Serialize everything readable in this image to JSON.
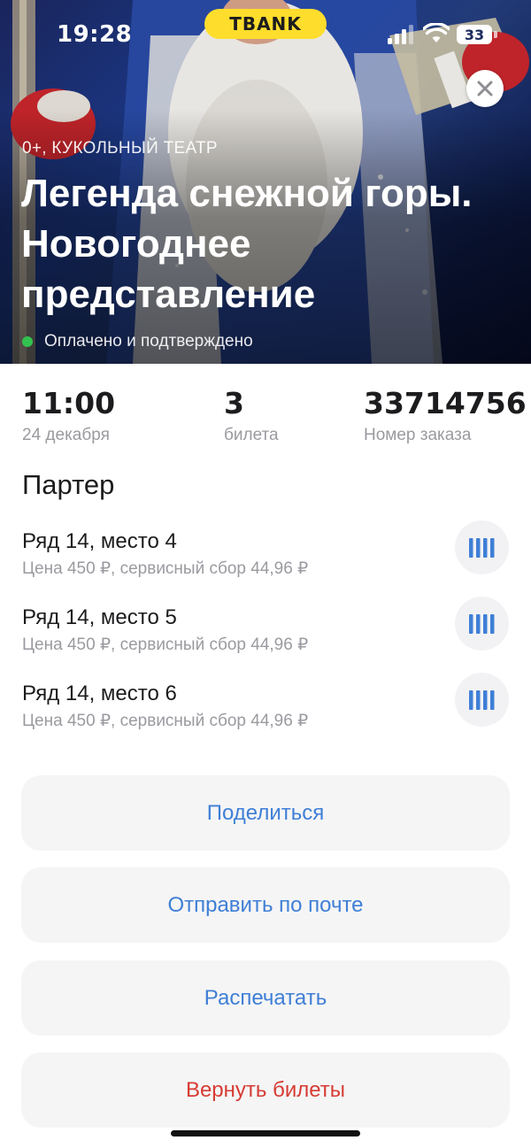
{
  "status_bar": {
    "time": "19:28",
    "brand": "TBANK",
    "battery": "33",
    "icons": [
      "signal-icon",
      "wifi-icon",
      "battery-icon"
    ]
  },
  "event": {
    "category": "0+, КУКОЛЬНЫЙ ТЕАТР",
    "title": "Легенда снежной горы. Новогоднее представление",
    "status": "Оплачено и подтверждено"
  },
  "info": {
    "time_value": "11:00",
    "time_label": "24 декабря",
    "count_value": "3",
    "count_label": "билета",
    "order_value": "33714756",
    "order_label": "Номер заказа"
  },
  "section": {
    "title": "Партер"
  },
  "tickets": [
    {
      "seat": "Ряд 14, место 4",
      "price": "Цена 450 ₽, сервисный сбор 44,96 ₽"
    },
    {
      "seat": "Ряд 14, место 5",
      "price": "Цена 450 ₽, сервисный сбор 44,96 ₽"
    },
    {
      "seat": "Ряд 14, место 6",
      "price": "Цена 450 ₽, сервисный сбор 44,96 ₽"
    }
  ],
  "actions": {
    "share": "Поделиться",
    "email": "Отправить по почте",
    "print": "Распечатать",
    "refund": "Вернуть билеты"
  },
  "colors": {
    "accent": "#3f7fd6",
    "danger": "#d63c34",
    "status_ok": "#33c24f",
    "brand": "#ffdd2d"
  }
}
